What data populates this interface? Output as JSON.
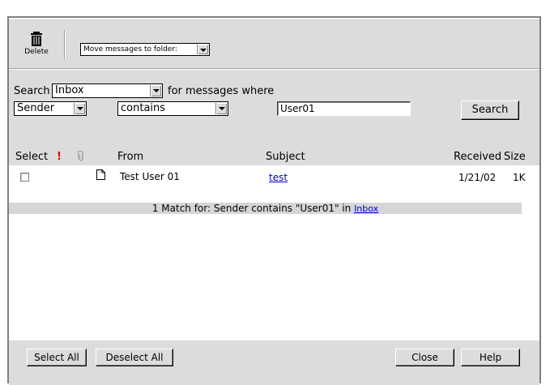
{
  "toolbar": {
    "delete_label": "Delete",
    "move_select": "Move messages to folder:"
  },
  "search": {
    "label": "Search",
    "folder": "Inbox",
    "suffix": "for messages where",
    "field": "Sender",
    "operator": "contains",
    "value": "User01",
    "button": "Search"
  },
  "list": {
    "headers": {
      "select": "Select",
      "priority": "!",
      "from": "From",
      "subject": "Subject",
      "received": "Received",
      "size": "Size"
    },
    "rows": [
      {
        "from": "Test User 01",
        "subject": "test",
        "received": "1/21/02",
        "size": "1K"
      }
    ],
    "match_text": "1 Match for: Sender contains \"User01\" in",
    "match_folder": "Inbox"
  },
  "footer": {
    "select_all": "Select All",
    "deselect_all": "Deselect All",
    "close": "Close",
    "help": "Help"
  },
  "colors": {
    "panel": "#dcdcdc",
    "priority": "#e00000",
    "link": "#0000cc"
  },
  "icons": [
    "trash-icon",
    "priority-icon",
    "attachment-icon",
    "document-icon",
    "dropdown-arrow-icon"
  ]
}
